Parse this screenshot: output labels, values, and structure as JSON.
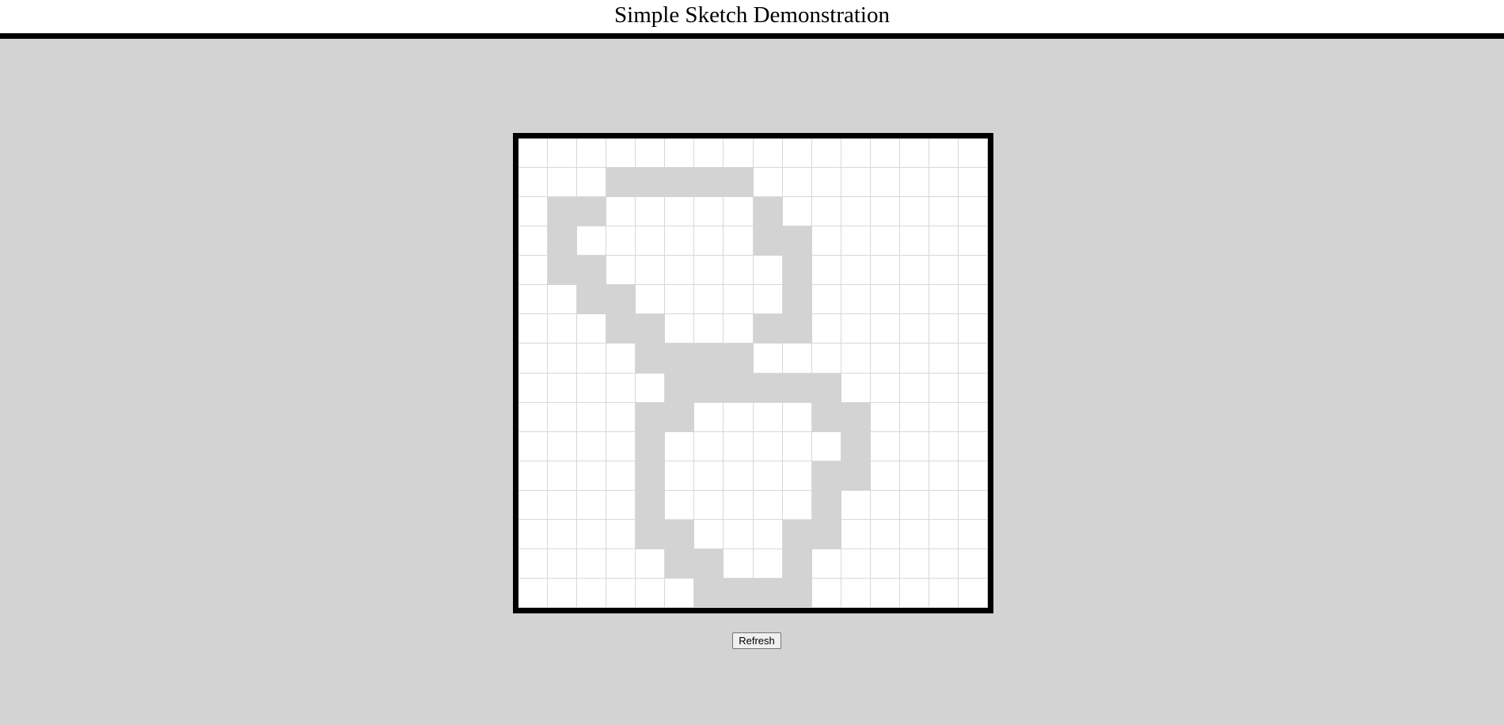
{
  "header": {
    "title": "Simple Sketch Demonstration"
  },
  "sketch": {
    "rows": 16,
    "cols": 16,
    "cell_color": "#ffffff",
    "filled_color": "#d3d3d3",
    "grid_line_color": "#d8d8d8",
    "filled_cells": [
      [
        1,
        3
      ],
      [
        1,
        4
      ],
      [
        1,
        5
      ],
      [
        1,
        6
      ],
      [
        1,
        7
      ],
      [
        2,
        1
      ],
      [
        2,
        2
      ],
      [
        2,
        8
      ],
      [
        3,
        1
      ],
      [
        3,
        8
      ],
      [
        3,
        9
      ],
      [
        4,
        1
      ],
      [
        4,
        2
      ],
      [
        4,
        9
      ],
      [
        5,
        2
      ],
      [
        5,
        3
      ],
      [
        5,
        9
      ],
      [
        6,
        3
      ],
      [
        6,
        4
      ],
      [
        6,
        8
      ],
      [
        6,
        9
      ],
      [
        7,
        4
      ],
      [
        7,
        5
      ],
      [
        7,
        6
      ],
      [
        7,
        7
      ],
      [
        8,
        5
      ],
      [
        8,
        6
      ],
      [
        8,
        7
      ],
      [
        8,
        8
      ],
      [
        8,
        9
      ],
      [
        8,
        10
      ],
      [
        9,
        4
      ],
      [
        9,
        5
      ],
      [
        9,
        10
      ],
      [
        9,
        11
      ],
      [
        10,
        4
      ],
      [
        10,
        11
      ],
      [
        11,
        4
      ],
      [
        11,
        10
      ],
      [
        11,
        11
      ],
      [
        12,
        4
      ],
      [
        12,
        10
      ],
      [
        13,
        4
      ],
      [
        13,
        5
      ],
      [
        13,
        9
      ],
      [
        13,
        10
      ],
      [
        14,
        5
      ],
      [
        14,
        6
      ],
      [
        14,
        9
      ],
      [
        15,
        6
      ],
      [
        15,
        7
      ],
      [
        15,
        8
      ],
      [
        15,
        9
      ]
    ]
  },
  "controls": {
    "refresh_label": "Refresh"
  }
}
